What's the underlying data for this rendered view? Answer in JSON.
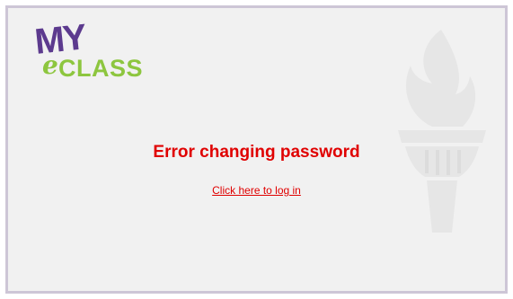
{
  "logo": {
    "my": "MY",
    "e": "e",
    "class": "CLASS"
  },
  "message": {
    "error_title": "Error changing password",
    "login_link": "Click here to log in"
  },
  "colors": {
    "error_red": "#e00000",
    "brand_purple": "#5c3a8e",
    "brand_green": "#8dc63f",
    "frame_border": "#cdc6d6"
  }
}
